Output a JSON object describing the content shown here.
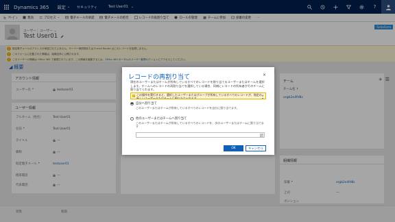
{
  "nav": {
    "app_name": "Dynamics 365",
    "area": "設定",
    "crumb": "セキュリティ",
    "record": "Test User01"
  },
  "commands": [
    {
      "label": "ﾂﾘｰﾋﾞｭ",
      "icon": "tree-icon"
    },
    {
      "label": "無効",
      "icon": "disable-icon"
    },
    {
      "label": "プロセス",
      "icon": "process-icon"
    },
    {
      "label": "電子メールの承認",
      "icon": "email-approve-icon"
    },
    {
      "label": "電子メールの拒否",
      "icon": "email-reject-icon"
    },
    {
      "label": "レコードの再割り当て",
      "icon": "reassign-icon"
    },
    {
      "label": "ロールの管理",
      "icon": "roles-icon"
    },
    {
      "label": "チームに参加",
      "icon": "join-team-icon"
    },
    {
      "label": "部署の変更",
      "icon": "change-unit-icon"
    }
  ],
  "header": {
    "entity_type": "ユーザー：ユーザー",
    "name": "Test User01",
    "badge": "TurboForm"
  },
  "notifications": [
    {
      "text": "既定電子メールのアドレスが承認されていません。サーバー側同期または E-mail Router はこのレコードを処理しません。",
      "link": ""
    },
    {
      "text": "このフォームに記載された情報は、組織全体に公開されます。",
      "link": ""
    },
    {
      "text": "このユーザーの情報は Office 365 で管理されています。この情報を編集するには、",
      "link": "Office 365 ポータルのユーザー管理セクション"
    }
  ],
  "notification_suffix": "にアクセスしてください。",
  "section": {
    "title": "概要"
  },
  "account_panel": {
    "title": "アカウント情報",
    "fields": [
      {
        "label": "ユーザー名",
        "value": "testuser01"
      }
    ]
  },
  "user_panel": {
    "title": "ユーザー情報",
    "fields": [
      {
        "label": "フルネーム（姓名）",
        "value": "Test User01"
      },
      {
        "label": "名前",
        "value": "Test User01"
      },
      {
        "label": "タイトル",
        "value": "---"
      },
      {
        "label": "職称",
        "value": "---"
      },
      {
        "label": "既定電子メール",
        "value": "testuser01"
      },
      {
        "label": "携帯電話",
        "value": "---"
      },
      {
        "label": "代表電話",
        "value": "---"
      }
    ]
  },
  "team_panel": {
    "title": "チーム",
    "column": "チーム名 ↑",
    "item": "orgb2e4fd8c"
  },
  "org_panel": {
    "title": "組織情報",
    "fields": [
      {
        "label": "部署",
        "value": "orgb2e4fd8c"
      },
      {
        "label": "上司",
        "value": "---"
      },
      {
        "label": "ポジション",
        "value": ""
      }
    ]
  },
  "status": {
    "label": "状態",
    "value": "有効"
  },
  "dialog": {
    "title": "レコードの再割り当て",
    "close": "×",
    "description": "現在のユーザーまたはチームが所有しているすべてのレコードを割り当てるユーザーまたはチームを選択します。チームへのレコードの再割り当てを選択している場合、同様にレコードの所有者がそのチームに割り当てられます。",
    "warning": "この操作を実行すると、選択したユーザーまたはグループが所有しているすべてのレコードが、指定の新しいユーザーまたはチームに割り当てられます。",
    "option_self": {
      "label": "自分へ割り当て",
      "desc": "このユーザーまたはチームが所有しているすべてのレコードを自分に割り当てます。"
    },
    "option_other": {
      "label": "他のユーザーまたはチームへ割り当て",
      "desc": "このユーザーまたはチームが所有しているすべてのレコードを、次のユーザーまたはチームに割り当てます"
    },
    "lookup_placeholder": "",
    "ok": "OK",
    "cancel": "キャンセル"
  },
  "colors": {
    "nav": "#002050",
    "link": "#1160b7",
    "warning_bg": "#fff7d9",
    "badge": "#2f8fd6"
  }
}
